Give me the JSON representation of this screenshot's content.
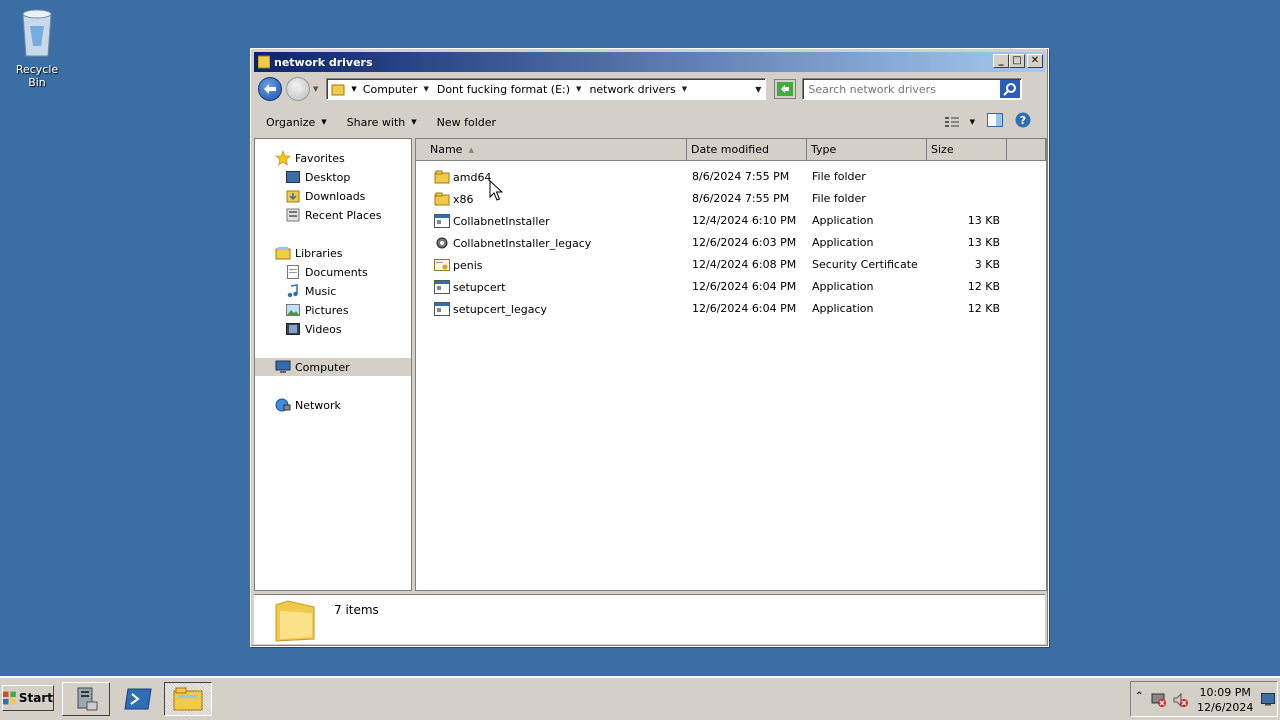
{
  "desktop": {
    "recycle_bin": {
      "label": "Recycle Bin",
      "icon": "recycle-bin-icon"
    }
  },
  "window": {
    "title": "network drivers",
    "breadcrumbs": [
      "Computer",
      "Dont fucking format (E:)",
      "network drivers"
    ],
    "search_placeholder": "Search network drivers",
    "toolbar": {
      "organize": "Organize",
      "share_with": "Share with",
      "new_folder": "New folder"
    },
    "nav": {
      "favorites": "Favorites",
      "desktop": "Desktop",
      "downloads": "Downloads",
      "recent_places": "Recent Places",
      "libraries": "Libraries",
      "documents": "Documents",
      "music": "Music",
      "pictures": "Pictures",
      "videos": "Videos",
      "computer": "Computer",
      "network": "Network"
    },
    "columns": {
      "name": "Name",
      "date_modified": "Date modified",
      "type": "Type",
      "size": "Size"
    },
    "files": [
      {
        "name": "amd64",
        "date": "8/6/2024 7:55 PM",
        "type": "File folder",
        "size": "",
        "icon": "folder-icon"
      },
      {
        "name": "x86",
        "date": "8/6/2024 7:55 PM",
        "type": "File folder",
        "size": "",
        "icon": "folder-icon"
      },
      {
        "name": "CollabnetInstaller",
        "date": "12/4/2024 6:10 PM",
        "type": "Application",
        "size": "13 KB",
        "icon": "application-icon"
      },
      {
        "name": "CollabnetInstaller_legacy",
        "date": "12/6/2024 6:03 PM",
        "type": "Application",
        "size": "13 KB",
        "icon": "gear-application-icon"
      },
      {
        "name": "penis",
        "date": "12/4/2024 6:08 PM",
        "type": "Security Certificate",
        "size": "3 KB",
        "icon": "certificate-icon"
      },
      {
        "name": "setupcert",
        "date": "12/6/2024 6:04 PM",
        "type": "Application",
        "size": "12 KB",
        "icon": "application-icon"
      },
      {
        "name": "setupcert_legacy",
        "date": "12/6/2024 6:04 PM",
        "type": "Application",
        "size": "12 KB",
        "icon": "application-icon"
      }
    ],
    "details": {
      "count": "7 items"
    }
  },
  "taskbar": {
    "start_label": "Start",
    "clock_time": "10:09 PM",
    "clock_date": "12/6/2024"
  },
  "colors": {
    "desktop_bg": "#3a6ea5",
    "title_gradient_start": "#0a246a",
    "title_gradient_end": "#a6caf0",
    "folder_yellow": "#f3c94a"
  }
}
